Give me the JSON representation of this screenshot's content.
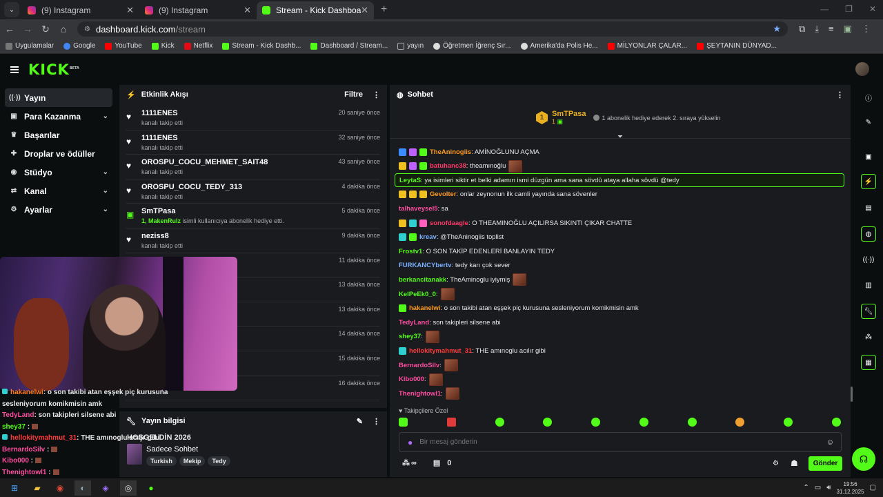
{
  "browser": {
    "tabs": [
      {
        "title": "(9) Instagram",
        "active": false
      },
      {
        "title": "(9) Instagram",
        "active": false
      },
      {
        "title": "Stream - Kick Dashboard",
        "active": true
      }
    ],
    "url_host": "dashboard.kick.com",
    "url_path": "/stream",
    "bookmarks": [
      "Uygulamalar",
      "Google",
      "YouTube",
      "Kick",
      "Netflix",
      "Stream - Kick Dashb...",
      "Dashboard / Stream...",
      "yayın",
      "Öğretmen İğrenç Sır...",
      "Amerika'da Polis He...",
      "MİLYONLAR ÇALAR...",
      "ŞEYTANIN DÜNYAD..."
    ]
  },
  "brand": {
    "logo": "KICK",
    "beta": "BETA",
    "accent": "#53fc18"
  },
  "sidebar": {
    "items": [
      {
        "label": "Yayın",
        "icon": "broadcast-icon",
        "active": true,
        "expandable": false
      },
      {
        "label": "Para Kazanma",
        "icon": "money-icon",
        "expandable": true
      },
      {
        "label": "Başarılar",
        "icon": "trophy-icon",
        "expandable": false
      },
      {
        "label": "Droplar ve ödüller",
        "icon": "gift-icon",
        "expandable": false
      },
      {
        "label": "Stüdyo",
        "icon": "studio-icon",
        "expandable": true
      },
      {
        "label": "Kanal",
        "icon": "channel-icon",
        "expandable": true
      },
      {
        "label": "Ayarlar",
        "icon": "gear-icon",
        "expandable": true
      }
    ]
  },
  "activity": {
    "title": "Etkinlik Akışı",
    "filter_label": "Filtre",
    "items": [
      {
        "name": "1111ENES",
        "sub": "kanalı takip etti",
        "time": "20 saniye önce",
        "type": "follow"
      },
      {
        "name": "1111ENES",
        "sub": "kanalı takip etti",
        "time": "32 saniye önce",
        "type": "follow"
      },
      {
        "name": "OROSPU_COCU_MEHMET_SAIT48",
        "sub": "kanalı takip etti",
        "time": "43 saniye önce",
        "type": "follow"
      },
      {
        "name": "OROSPU_COCU_TEDY_313",
        "sub": "kanalı takip etti",
        "time": "4 dakika önce",
        "type": "follow"
      },
      {
        "name": "SmTPasa",
        "sub_highlight": "1, MakenRulz",
        "sub": " isimli kullanıcıya abonelik hediye etti.",
        "time": "5 dakika önce",
        "type": "gift"
      },
      {
        "name": "neziss8",
        "sub": "kanalı takip etti",
        "time": "9 dakika önce",
        "type": "follow"
      },
      {
        "name": "",
        "sub": "",
        "time": "11 dakika önce",
        "type": "follow"
      },
      {
        "name": "",
        "sub": "",
        "time": "13 dakika önce",
        "type": "follow"
      },
      {
        "name": "",
        "sub": "",
        "time": "13 dakika önce",
        "type": "follow"
      },
      {
        "name": "",
        "sub": "",
        "time": "14 dakika önce",
        "type": "follow"
      },
      {
        "name": "",
        "sub": "",
        "time": "15 dakika önce",
        "type": "follow"
      },
      {
        "name": "",
        "sub": "kanalı takip etti",
        "time": "16 dakika önce",
        "type": "follow"
      }
    ]
  },
  "stream_info": {
    "title": "Yayın bilgisi",
    "stream_title": "HOŞGELDİN 2026",
    "category": "Sadece Sohbet",
    "tags": [
      "Turkish",
      "Mekip",
      "Tedy"
    ]
  },
  "overlay_chat": [
    {
      "user": "hakanelwi",
      "color": "#ff7a1a",
      "text": ": o son takibi atan eşşek piç kurusuna",
      "badge": true
    },
    {
      "user": "",
      "color": "#fff",
      "text": "sesleniyorum komikmisin amk"
    },
    {
      "user": "TedyLand",
      "color": "#ff4da0",
      "text": ": son takipleri silsene abi"
    },
    {
      "user": "shey37",
      "color": "#53fc18",
      "text": " :",
      "emote": true
    },
    {
      "user": "hellokitymahmut_31",
      "color": "#ff3a3a",
      "text": ": THE amınoglu acılır gibi",
      "badge": true
    },
    {
      "user": "BernardoSilv",
      "color": "#ff4da0",
      "text": " :",
      "emote": true
    },
    {
      "user": "Kibo000",
      "color": "#ff4da0",
      "text": " :",
      "emote": true
    },
    {
      "user": "Thenightowl1",
      "color": "#ff4da0",
      "text": " :",
      "emote": true
    }
  ],
  "chat": {
    "title": "Sohbet",
    "leader": {
      "rank": "1",
      "name": "SmTPasa",
      "count": "1",
      "notice": "1 abonelik hediye ederek 2. sıraya yükselin"
    },
    "messages": [
      {
        "user": "TheAninogiis",
        "color": "#ff9a1a",
        "text": ": AMİNOĞLUNU AÇMA",
        "badges": [
          "#3a8cff",
          "#c060ff",
          "#53fc18"
        ]
      },
      {
        "user": "batuhanc38",
        "color": "#ff3a6a",
        "text": ": theamınoğlu",
        "badges": [
          "#f0c020",
          "#c060ff",
          "#53fc18"
        ],
        "emote": true
      },
      {
        "user": "LeytaS",
        "color": "#53fc18",
        "text": ": ya isimleri siktir et belki adamın ismi düzgün ama sana sövdü ataya allaha sövdü @tedy",
        "highlight": true
      },
      {
        "user": "Gevolter",
        "color": "#ff9a1a",
        "text": ": onlar zeynonun ilk camli yayında sana sövenler",
        "badges": [
          "#f0c020",
          "#f0c020",
          "#f0c020"
        ]
      },
      {
        "user": "talhaveysel5",
        "color": "#ff4da0",
        "text": ": sa"
      },
      {
        "user": "sonofdaagle",
        "color": "#ff3a6a",
        "text": ": O THEAMINOĞLU AÇILIRSA SIKINTI ÇIKAR CHATTE",
        "badges": [
          "#f0c020",
          "#30d0d0",
          "#ff60c0"
        ]
      },
      {
        "user": "kreav",
        "color": "#7ab0ff",
        "text": ": @TheAninogiis toplist",
        "badges": [
          "#30d0d0",
          "#53fc18"
        ]
      },
      {
        "user": "Frostv1",
        "color": "#53fc18",
        "text": ": O SON TAKİP EDENLERİ BANLAYIN TEDY"
      },
      {
        "user": "FURKANCYbertv",
        "color": "#7ab0ff",
        "text": ": tedy karı çok sever"
      },
      {
        "user": "berkancitanakk",
        "color": "#53fc18",
        "text": ": TheAminoglu iyiymiş",
        "emote": true
      },
      {
        "user": "KelPeEk0_0",
        "color": "#53fc18",
        "text": ":",
        "emote": true
      },
      {
        "user": "hakanelwi",
        "color": "#ff9a1a",
        "text": ": o son takibi atan eşşek piç kurusuna sesleniyorum komikmisin amk",
        "badges": [
          "#53fc18"
        ]
      },
      {
        "user": "TedyLand",
        "color": "#ff4da0",
        "text": ": son takipleri silsene abi"
      },
      {
        "user": "shey37",
        "color": "#53fc18",
        "text": ":",
        "emote": true
      },
      {
        "user": "hellokitymahmut_31",
        "color": "#ff3a3a",
        "text": ": THE amınoglu acılır gibi",
        "badges": [
          "#30d0d0"
        ]
      },
      {
        "user": "BernardoSilv",
        "color": "#ff4da0",
        "text": ":",
        "emote": true
      },
      {
        "user": "Kibo000",
        "color": "#ff4da0",
        "text": ":",
        "emote": true
      },
      {
        "user": "Thenightowl1",
        "color": "#ff4da0",
        "text": ":",
        "emote": true
      }
    ],
    "followers_only": "Takipçilere Özel",
    "input_placeholder": "Bir mesaj gönderin",
    "infinite": "∞",
    "gift_count": "0",
    "send_label": "Gönder"
  },
  "taskbar": {
    "time": "19:56",
    "date": "31.12.2025"
  }
}
